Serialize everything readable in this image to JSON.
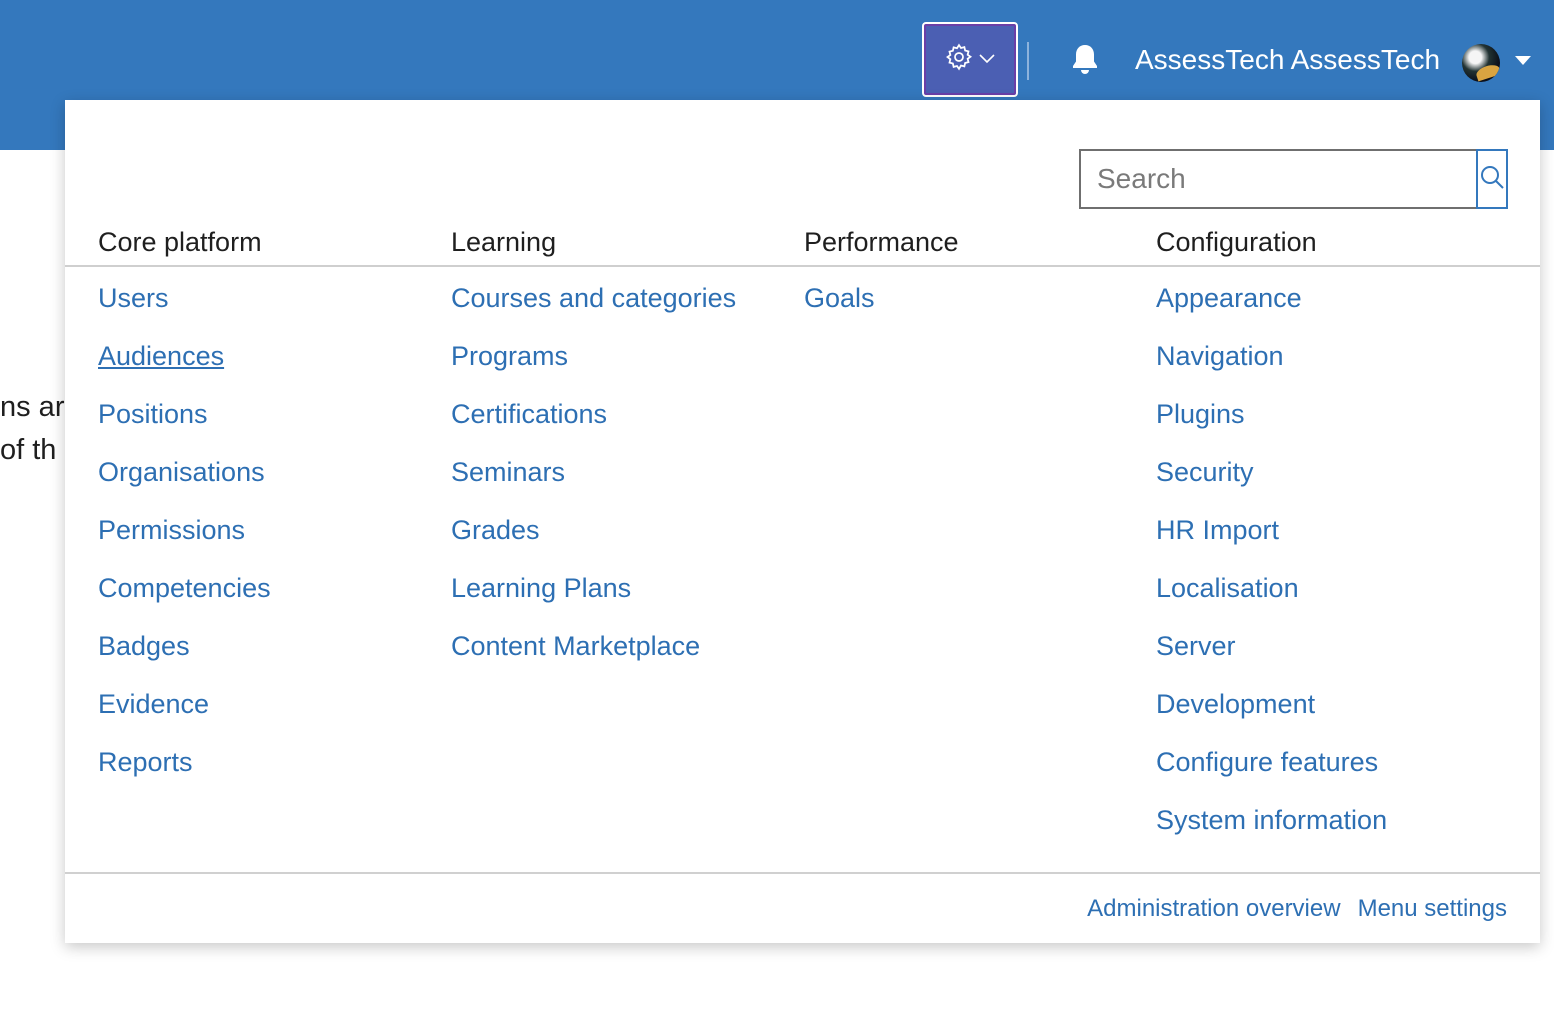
{
  "header": {
    "username": "AssessTech AssessTech",
    "colors": {
      "bar": "#3478bd",
      "link": "#2d6fb3"
    },
    "icons": {
      "settings": "gear-icon",
      "settings_caret": "chevron-down-icon",
      "notifications": "bell-icon",
      "user_menu": "caret-down-icon"
    }
  },
  "background_text": {
    "line1": "ns are",
    "line2": "of th"
  },
  "admin_menu": {
    "search": {
      "placeholder": "Search"
    },
    "columns": [
      {
        "heading": "Core platform",
        "items": [
          "Users",
          "Audiences",
          "Positions",
          "Organisations",
          "Permissions",
          "Competencies",
          "Badges",
          "Evidence",
          "Reports"
        ]
      },
      {
        "heading": "Learning",
        "items": [
          "Courses and categories",
          "Programs",
          "Certifications",
          "Seminars",
          "Grades",
          "Learning Plans",
          "Content Marketplace"
        ]
      },
      {
        "heading": "Performance",
        "items": [
          "Goals"
        ]
      },
      {
        "heading": "Configuration",
        "items": [
          "Appearance",
          "Navigation",
          "Plugins",
          "Security",
          "HR Import",
          "Localisation",
          "Server",
          "Development",
          "Configure features",
          "System information"
        ]
      }
    ],
    "footer": {
      "overview": "Administration overview",
      "settings": "Menu settings"
    }
  }
}
